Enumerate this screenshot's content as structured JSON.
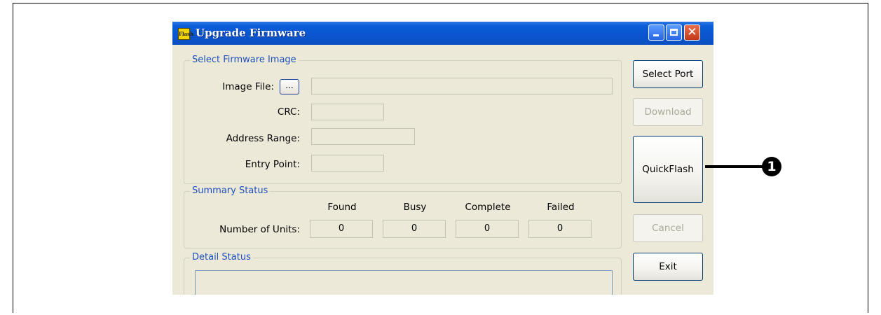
{
  "window": {
    "title": "Upgrade Firmware",
    "icon_text": "Flash",
    "controls": {
      "minimize": "minimize-icon",
      "maximize": "maximize-icon",
      "close": "close-icon",
      "close_glyph": "✕"
    }
  },
  "firmware_group": {
    "label": "Select Firmware Image",
    "image_file_label": "Image File:",
    "browse_label": "...",
    "crc_label": "CRC:",
    "address_range_label": "Address Range:",
    "entry_point_label": "Entry Point:",
    "image_file_value": "",
    "crc_value": "",
    "address_range_value": "",
    "entry_point_value": ""
  },
  "summary": {
    "label": "Summary Status",
    "row_label": "Number of Units:",
    "columns": [
      "Found",
      "Busy",
      "Complete",
      "Failed"
    ],
    "values": [
      "0",
      "0",
      "0",
      "0"
    ]
  },
  "detail": {
    "label": "Detail Status",
    "text": ""
  },
  "buttons": {
    "select_port": "Select Port",
    "download": "Download",
    "quickflash": "QuickFlash",
    "cancel": "Cancel",
    "exit": "Exit"
  },
  "callout": {
    "number": "1"
  }
}
